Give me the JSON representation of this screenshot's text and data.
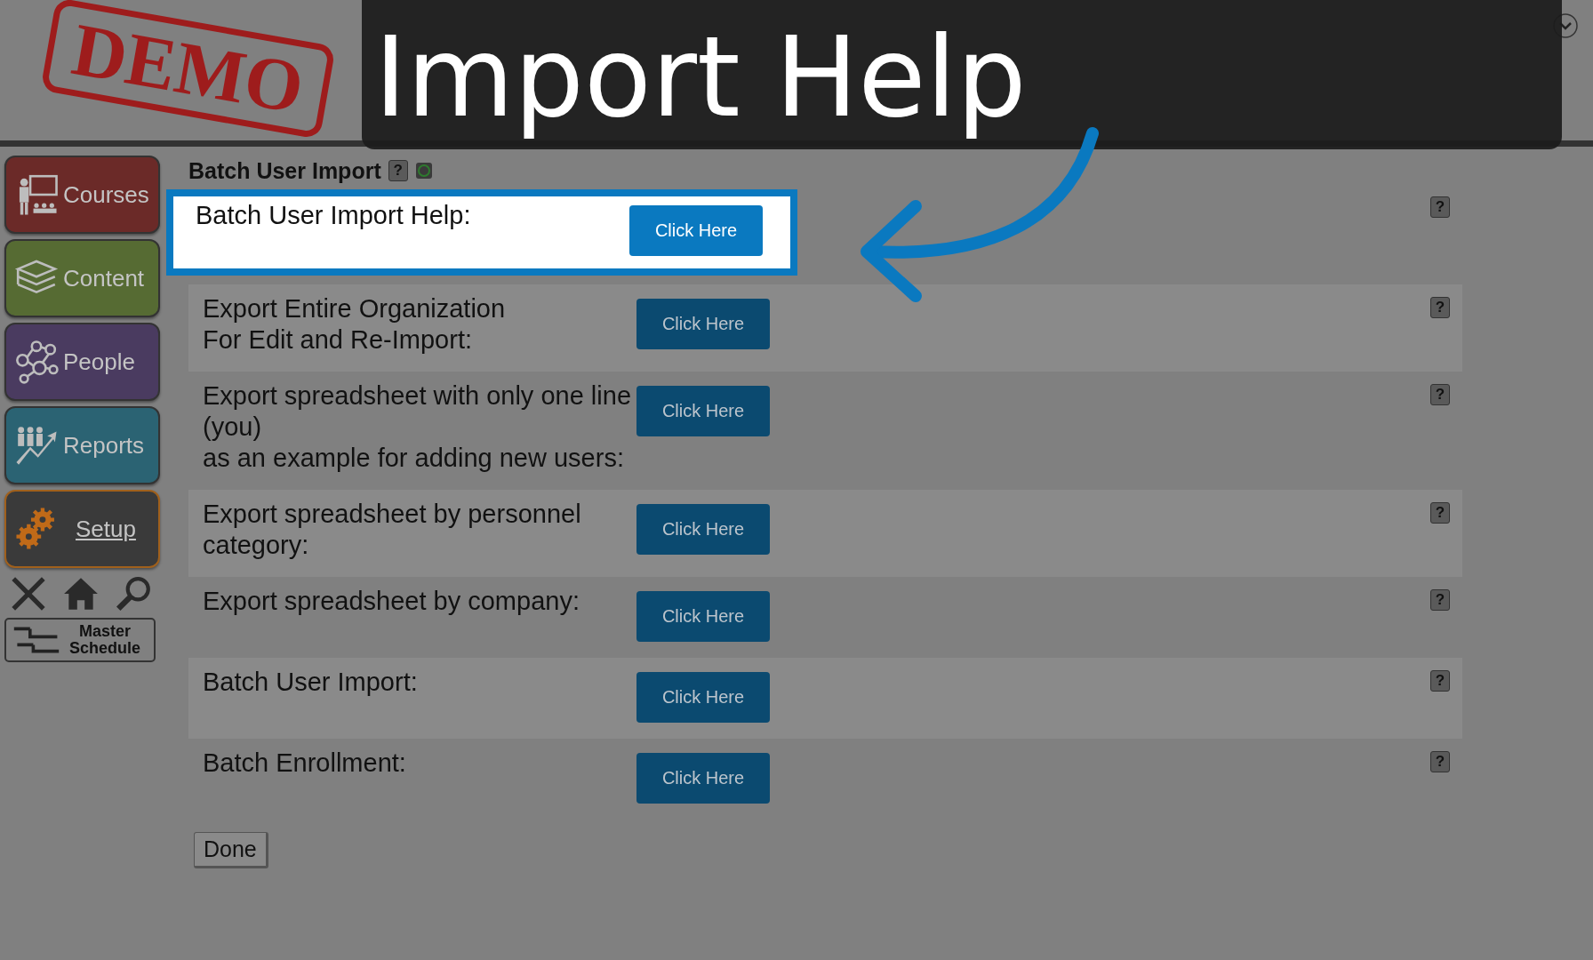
{
  "header": {
    "stamp": "DEMO"
  },
  "banner": {
    "title": "Import Help"
  },
  "nav": [
    {
      "label": "Courses",
      "kind": "courses",
      "selected": false
    },
    {
      "label": "Content",
      "kind": "content",
      "selected": false
    },
    {
      "label": "People",
      "kind": "people",
      "selected": false
    },
    {
      "label": "Reports",
      "kind": "reports",
      "selected": false
    },
    {
      "label": "Setup",
      "kind": "setup",
      "selected": true
    }
  ],
  "master_schedule": "Master Schedule",
  "page": {
    "title": "Batch User Import",
    "help": "?"
  },
  "rows": [
    {
      "label": "Batch User Import Help:",
      "button": "Click Here",
      "help": "?",
      "highlighted": true
    },
    {
      "label": "Export Entire Organization\nFor Edit and Re-Import:",
      "button": "Click Here",
      "help": "?",
      "highlighted": false
    },
    {
      "label": "Export spreadsheet with only one line\n(you)\nas an example for adding new users:",
      "button": "Click Here",
      "help": "?",
      "highlighted": false
    },
    {
      "label": "Export spreadsheet by personnel\ncategory:",
      "button": "Click Here",
      "help": "?",
      "highlighted": false
    },
    {
      "label": "Export spreadsheet by company:",
      "button": "Click Here",
      "help": "?",
      "highlighted": false
    },
    {
      "label": "Batch User Import:",
      "button": "Click Here",
      "help": "?",
      "highlighted": false
    },
    {
      "label": "Batch Enrollment:",
      "button": "Click Here",
      "help": "?",
      "highlighted": false
    }
  ],
  "done": "Done"
}
